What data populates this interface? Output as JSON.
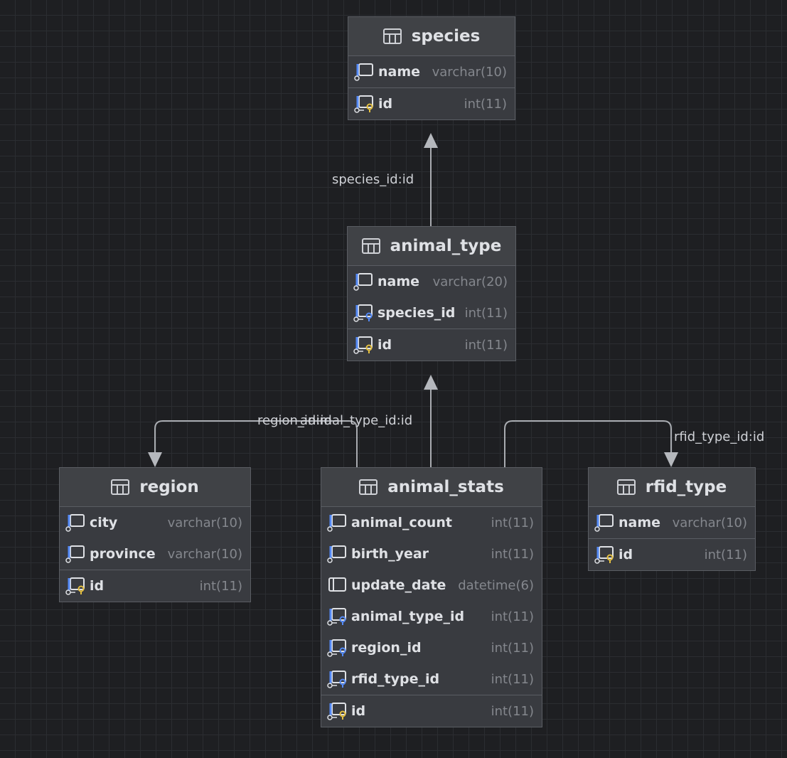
{
  "tables": {
    "species": {
      "title": "species",
      "columns": [
        {
          "name": "name",
          "type": "varchar(10)"
        }
      ],
      "pk": {
        "name": "id",
        "type": "int(11)"
      }
    },
    "animal_type": {
      "title": "animal_type",
      "columns": [
        {
          "name": "name",
          "type": "varchar(20)"
        },
        {
          "name": "species_id",
          "type": "int(11)"
        }
      ],
      "pk": {
        "name": "id",
        "type": "int(11)"
      }
    },
    "region": {
      "title": "region",
      "columns": [
        {
          "name": "city",
          "type": "varchar(10)"
        },
        {
          "name": "province",
          "type": "varchar(10)"
        }
      ],
      "pk": {
        "name": "id",
        "type": "int(11)"
      }
    },
    "animal_stats": {
      "title": "animal_stats",
      "columns": [
        {
          "name": "animal_count",
          "type": "int(11)"
        },
        {
          "name": "birth_year",
          "type": "int(11)"
        },
        {
          "name": "update_date",
          "type": "datetime(6)"
        },
        {
          "name": "animal_type_id",
          "type": "int(11)"
        },
        {
          "name": "region_id",
          "type": "int(11)"
        },
        {
          "name": "rfid_type_id",
          "type": "int(11)"
        }
      ],
      "pk": {
        "name": "id",
        "type": "int(11)"
      }
    },
    "rfid_type": {
      "title": "rfid_type",
      "columns": [
        {
          "name": "name",
          "type": "varchar(10)"
        }
      ],
      "pk": {
        "name": "id",
        "type": "int(11)"
      }
    }
  },
  "relations": {
    "species_id": "species_id:id",
    "region_id": "region_id:id",
    "animal_type_id": "animal_type_id:id",
    "rfid_type_id": "rfid_type_id:id"
  }
}
